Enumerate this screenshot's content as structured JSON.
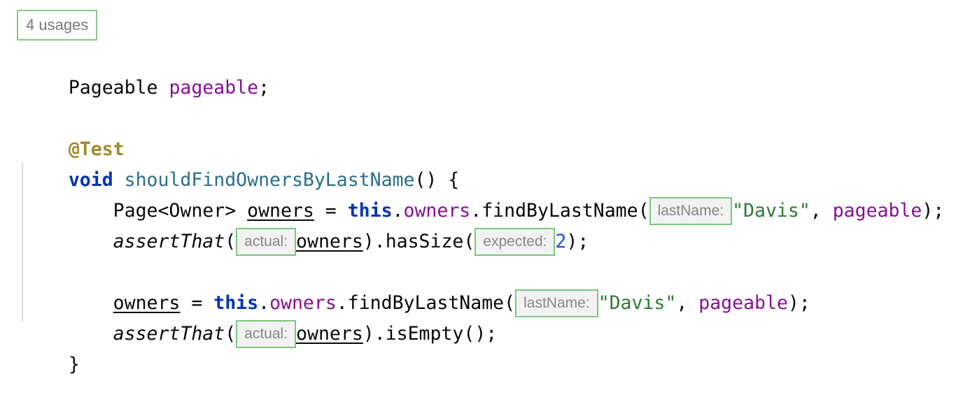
{
  "editor": {
    "language": "java",
    "background": "#ffffff",
    "colors": {
      "keyword": "#0033b3",
      "annotation": "#9e8c2e",
      "method_declaration": "#2b6e8a",
      "field": "#871094",
      "string": "#2a7a34",
      "number": "#1750eb",
      "plain_text": "#080808",
      "inlay_background": "#f2f2f2",
      "inlay_text": "#868686",
      "highlight_border": "#79c67f",
      "indent_guide": "#dcdcdc"
    }
  },
  "usages_hint": {
    "label": "4 usages"
  },
  "lines": {
    "field_decl": {
      "type": "Pageable",
      "name": "pageable",
      "semicolon": ";",
      "space": " "
    },
    "annotation": {
      "text": "@Test"
    },
    "method_signature": {
      "keyword": "void",
      "space": " ",
      "name": "shouldFindOwnersByLastName",
      "tail": "() {"
    },
    "stmt1": {
      "indent": "    ",
      "type": "Page<Owner> ",
      "var": "owners",
      "assign": " = ",
      "this": "this",
      "dot1": ".",
      "field": "owners",
      "dot2": ".",
      "method": "findByLastName",
      "open_paren": "(",
      "hint": "lastName:",
      "arg_string": "\"Davis\"",
      "comma": ", ",
      "arg2": "pageable",
      "close": ");"
    },
    "stmt2": {
      "indent": "    ",
      "assert": "assertThat",
      "open_paren": "(",
      "hint1": "actual:",
      "var": "owners",
      "mid": ").hasSize(",
      "hint2": "expected:",
      "number": "2",
      "close": ");"
    },
    "stmt3": {
      "indent": "    ",
      "var": "owners",
      "assign": " = ",
      "this": "this",
      "dot1": ".",
      "field": "owners",
      "dot2": ".",
      "method": "findByLastName",
      "open_paren": "(",
      "hint": "lastName:",
      "arg_string": "\"Davis\"",
      "comma": ", ",
      "arg2": "pageable",
      "close": ");"
    },
    "stmt4": {
      "indent": "    ",
      "assert": "assertThat",
      "open_paren": "(",
      "hint1": "actual:",
      "var": "owners",
      "close": ").isEmpty();"
    },
    "closing_brace": {
      "text": "}"
    }
  }
}
